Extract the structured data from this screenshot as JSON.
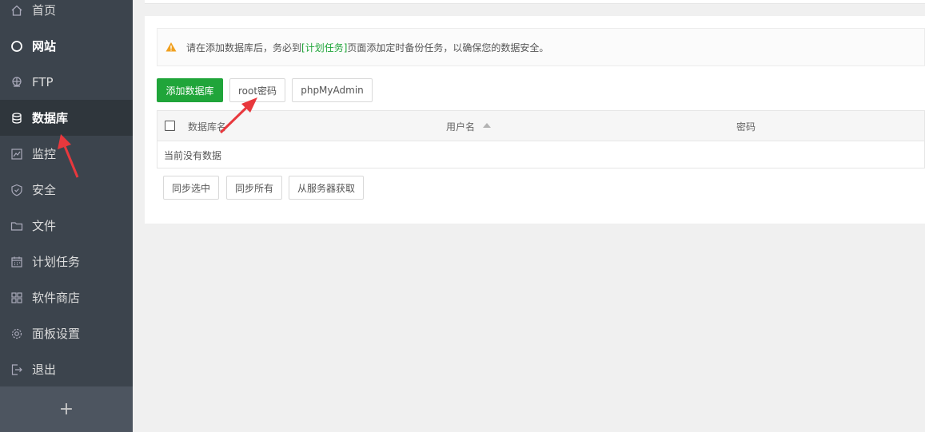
{
  "sidebar": {
    "items": [
      {
        "label": "首页",
        "icon": "home-icon"
      },
      {
        "label": "网站",
        "icon": "globe-icon"
      },
      {
        "label": "FTP",
        "icon": "ftp-icon"
      },
      {
        "label": "数据库",
        "icon": "database-icon"
      },
      {
        "label": "监控",
        "icon": "monitor-icon"
      },
      {
        "label": "安全",
        "icon": "shield-icon"
      },
      {
        "label": "文件",
        "icon": "folder-icon"
      },
      {
        "label": "计划任务",
        "icon": "calendar-icon"
      },
      {
        "label": "软件商店",
        "icon": "grid-icon"
      },
      {
        "label": "面板设置",
        "icon": "gear-icon"
      },
      {
        "label": "退出",
        "icon": "logout-icon"
      }
    ],
    "active": "数据库",
    "add_label": "+"
  },
  "notice": {
    "prefix": "请在添加数据库后，务必到",
    "link": "[计划任务]",
    "suffix": "页面添加定时备份任务，以确保您的数据安全。"
  },
  "toolbar": {
    "add_db": "添加数据库",
    "root_pwd": "root密码",
    "phpmyadmin": "phpMyAdmin"
  },
  "table": {
    "columns": [
      "数据库名",
      "用户名",
      "密码"
    ],
    "empty": "当前没有数据"
  },
  "actions": {
    "sync_selected": "同步选中",
    "sync_all": "同步所有",
    "fetch_server": "从服务器获取"
  },
  "colors": {
    "accent": "#20a53a",
    "sidebar_bg": "#3c444d",
    "annotation": "#e8383d"
  }
}
